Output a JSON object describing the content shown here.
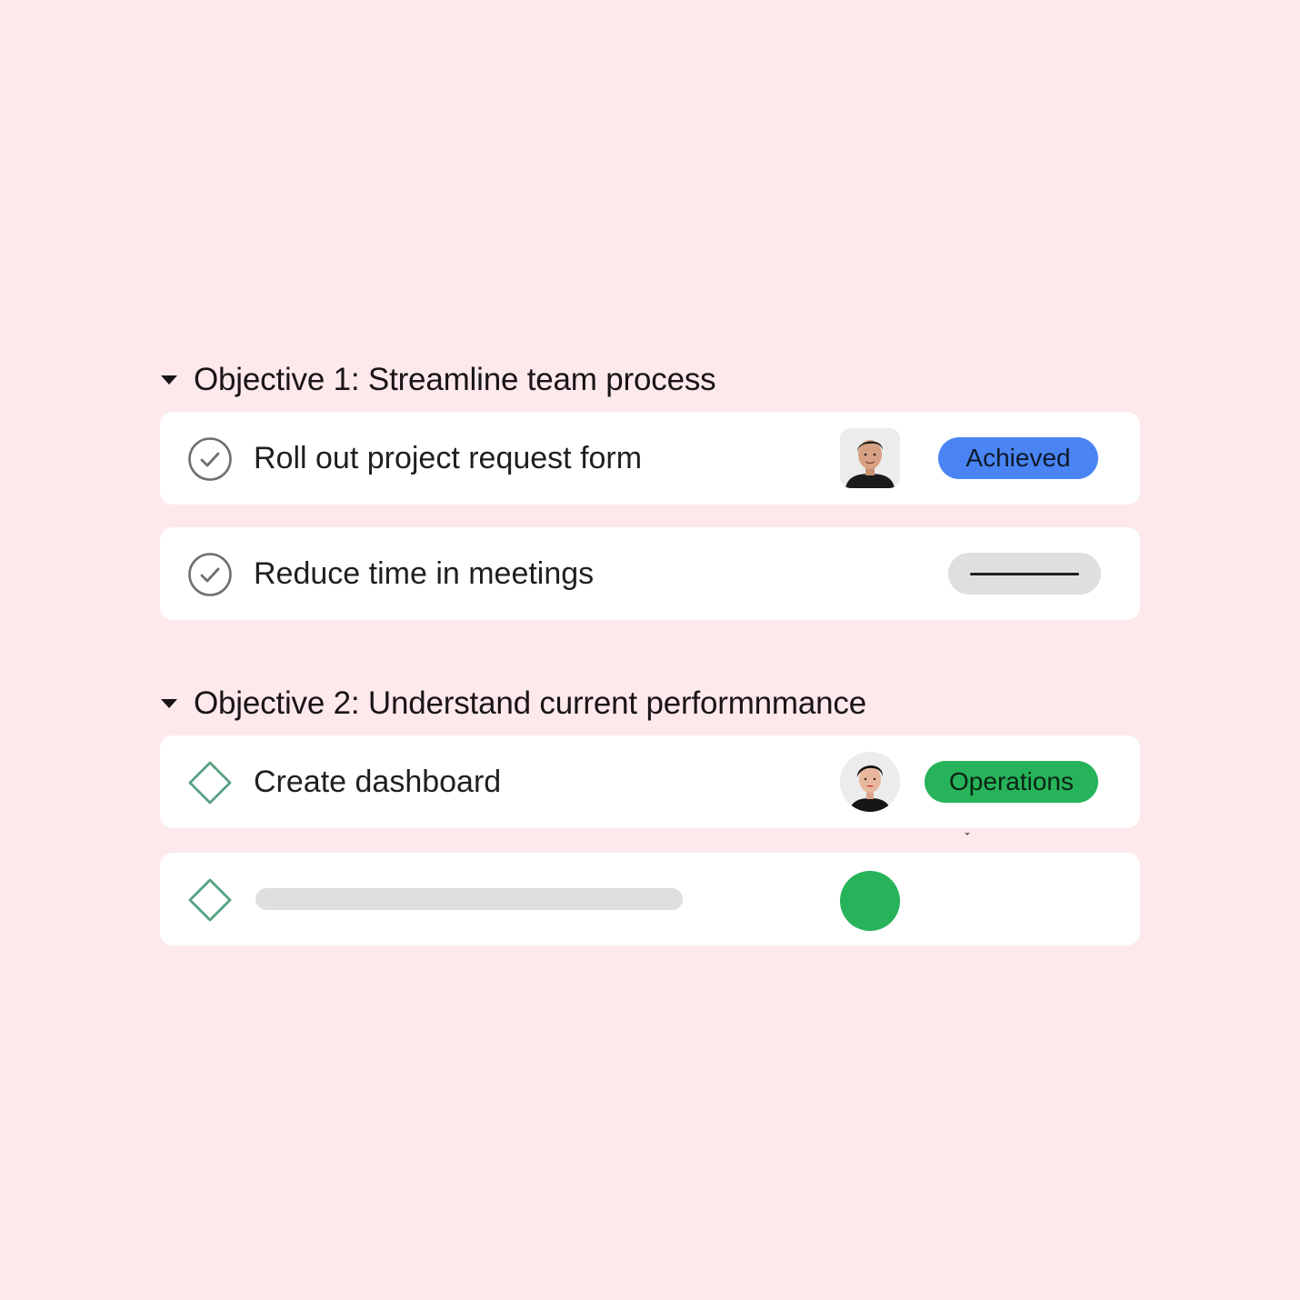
{
  "objectives": [
    {
      "title": "Objective 1: Streamline team process",
      "expanded": true,
      "key_results": [
        {
          "title": "Roll out project request form",
          "status_icon": "check-circle-icon",
          "assignee_avatar": "male-avatar",
          "tag": {
            "label": "Achieved",
            "color": "#4a84f4"
          }
        },
        {
          "title": "Reduce time in meetings",
          "status_icon": "check-circle-icon",
          "assignee_avatar": null,
          "tag": {
            "label": "",
            "placeholder": "dash",
            "color": "#e0dfde"
          }
        }
      ]
    },
    {
      "title": "Objective 2: Understand current performnmance",
      "expanded": true,
      "key_results": [
        {
          "title": "Create dashboard",
          "status_icon": "diamond-icon",
          "assignee_avatar": "female-avatar",
          "tag": {
            "label": "Operations",
            "color": "#26b35a"
          }
        },
        {
          "title": "",
          "status_icon": "diamond-icon",
          "assignee_avatar": "green-dot",
          "tag": null,
          "loading": true
        }
      ]
    }
  ],
  "colors": {
    "background": "#fde9ec",
    "card": "#ffffff",
    "check_icon": "#6d6e6f",
    "diamond_icon": "#58a182",
    "achieved": "#4a84f4",
    "operations": "#26b35a",
    "skeleton": "#e0dfde"
  }
}
